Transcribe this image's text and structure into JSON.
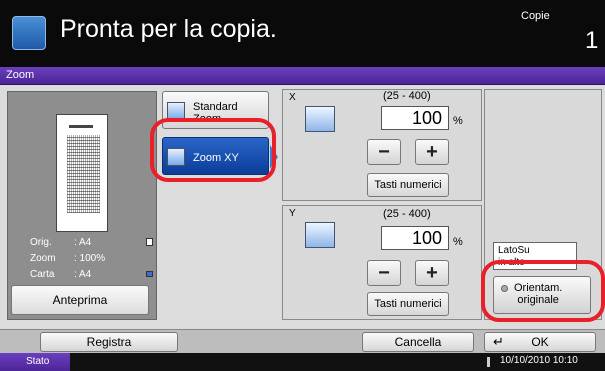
{
  "header": {
    "title": "Pronta per la copia.",
    "copies_label": "Copie",
    "copies_value": "1",
    "app_icon": "copy-icon"
  },
  "section": {
    "title": "Zoom"
  },
  "preview": {
    "orig_label": "Orig.",
    "orig_value": ": A4",
    "zoom_label": "Zoom",
    "zoom_value": ": 100%",
    "carta_label": "Carta",
    "carta_value": ": A4",
    "preview_button": "Anteprima"
  },
  "modes": {
    "standard_label": "Standard\nZoom",
    "zoomxy_label": "Zoom XY"
  },
  "x_axis": {
    "letter": "X",
    "range": "(25 - 400)",
    "value": "100",
    "unit": "%",
    "minus": "−",
    "plus": "+",
    "numeric_keys": "Tasti numerici"
  },
  "y_axis": {
    "letter": "Y",
    "range": "(25 - 400)",
    "value": "100",
    "unit": "%",
    "minus": "−",
    "plus": "+",
    "numeric_keys": "Tasti numerici"
  },
  "orientation": {
    "label": "LatoSu\nin alto",
    "button": "Orientam.\noriginale"
  },
  "bottom": {
    "registra": "Registra",
    "cancella": "Cancella",
    "ok": "OK",
    "enter_glyph": "↵"
  },
  "status": {
    "label": "Stato",
    "datetime": "10/10/2010  10:10"
  },
  "colors": {
    "accent_purple": "#5a2fab",
    "selected_blue": "#1a55b8",
    "highlight_red": "#e8202a"
  }
}
